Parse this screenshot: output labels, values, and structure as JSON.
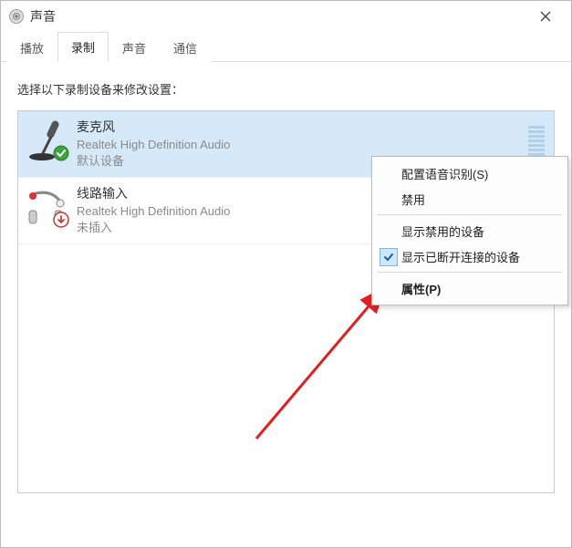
{
  "window": {
    "title": "声音"
  },
  "tabs": {
    "playback": "播放",
    "record": "录制",
    "sound": "声音",
    "comm": "通信"
  },
  "instruction": "选择以下录制设备来修改设置：",
  "devices": {
    "mic": {
      "name": "麦克风",
      "sub": "Realtek High Definition Audio",
      "status": "默认设备"
    },
    "linein": {
      "name": "线路输入",
      "sub": "Realtek High Definition Audio",
      "status": "未插入"
    }
  },
  "context_menu": {
    "configure": "配置语音识别(S)",
    "disable": "禁用",
    "show_disabled": "显示禁用的设备",
    "show_disconnected": "显示已断开连接的设备",
    "properties": "属性(P)"
  }
}
